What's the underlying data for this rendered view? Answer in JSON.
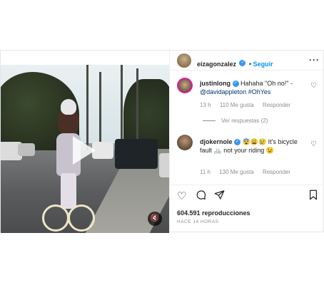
{
  "post": {
    "author": "eizagonzalez",
    "follow_label": "Seguir",
    "more_icon": "more-options-icon"
  },
  "comments": [
    {
      "username": "justinlong",
      "verified": true,
      "text": "Hahaha \"Oh no!\" - ",
      "mention": "@davidappleton",
      "hashtag": "#OhYes",
      "time": "13 h",
      "likes": "110 Me gusta",
      "reply_label": "Responder"
    },
    {
      "username": "djokernole",
      "verified": true,
      "emoji": "😨😩😢",
      "text_a": " It's bicycle fault ",
      "bike_emoji": "🚲",
      "text_b": " not your riding ",
      "smile": "😉",
      "time": "11 h",
      "likes": "130 Me gusta",
      "reply_label": "Responder"
    }
  ],
  "view_replies": "Ver respuestas (2)",
  "stats": {
    "views": "604.591 reproducciones",
    "posted": "HACE 14 HORAS"
  },
  "colors": {
    "link": "#0095f6",
    "verified": "#3897f0",
    "muted": "#8e8e8e"
  }
}
